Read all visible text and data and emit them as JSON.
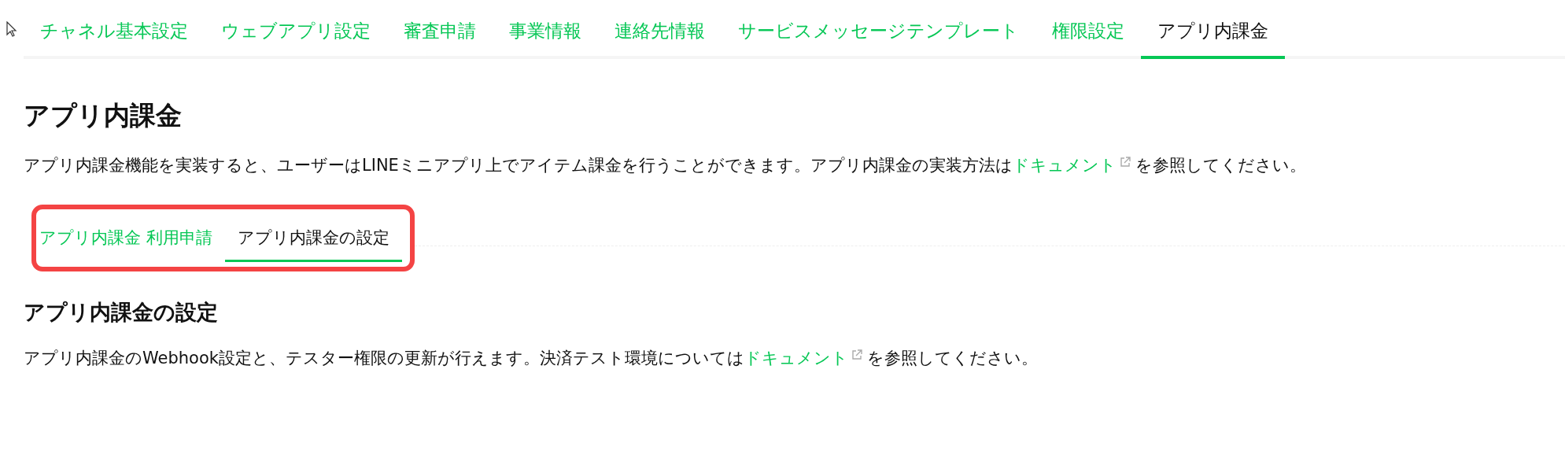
{
  "tabs": [
    {
      "label": "チャネル基本設定",
      "selected": false
    },
    {
      "label": "ウェブアプリ設定",
      "selected": false
    },
    {
      "label": "審査申請",
      "selected": false
    },
    {
      "label": "事業情報",
      "selected": false
    },
    {
      "label": "連絡先情報",
      "selected": false
    },
    {
      "label": "サービスメッセージテンプレート",
      "selected": false
    },
    {
      "label": "権限設定",
      "selected": false
    },
    {
      "label": "アプリ内課金",
      "selected": true
    }
  ],
  "page_title": "アプリ内課金",
  "description": {
    "before": "アプリ内課金機能を実装すると、ユーザーはLINEミニアプリ上でアイテム課金を行うことができます。アプリ内課金の実装方法は",
    "link": "ドキュメント",
    "after": "を参照してください。"
  },
  "sub_tabs": [
    {
      "label": "アプリ内課金 利用申請",
      "selected": false
    },
    {
      "label": "アプリ内課金の設定",
      "selected": true
    }
  ],
  "section": {
    "title": "アプリ内課金の設定",
    "description": {
      "before": "アプリ内課金のWebhook設定と、テスター権限の更新が行えます。決済テスト環境については",
      "link": "ドキュメント",
      "after": "を参照してください。"
    }
  }
}
